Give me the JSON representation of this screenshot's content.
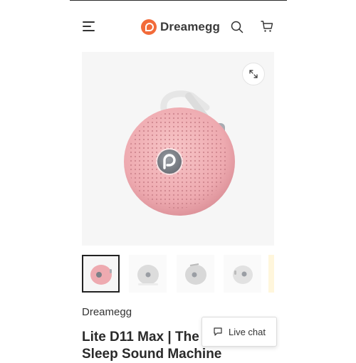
{
  "header": {
    "brand_name": "Dreamegg",
    "menu_icon": "hamburger-menu-icon",
    "search_icon": "search-icon",
    "cart_icon": "cart-icon",
    "brand_color": "#f26b3a"
  },
  "gallery": {
    "expand_icon": "expand-icon",
    "product_color": "#f2b1b5",
    "thumbnails": [
      {
        "variant": "pink",
        "active": true
      },
      {
        "variant": "white",
        "active": false
      },
      {
        "variant": "white",
        "active": false
      },
      {
        "variant": "white",
        "active": false
      },
      {
        "variant": "yellow",
        "active": false
      }
    ]
  },
  "product": {
    "brand": "Dreamegg",
    "title": "Lite D11 Max | The Portable Sleep Sound Machine"
  },
  "chat": {
    "label": "Live chat",
    "icon": "chat-bubble-icon"
  }
}
